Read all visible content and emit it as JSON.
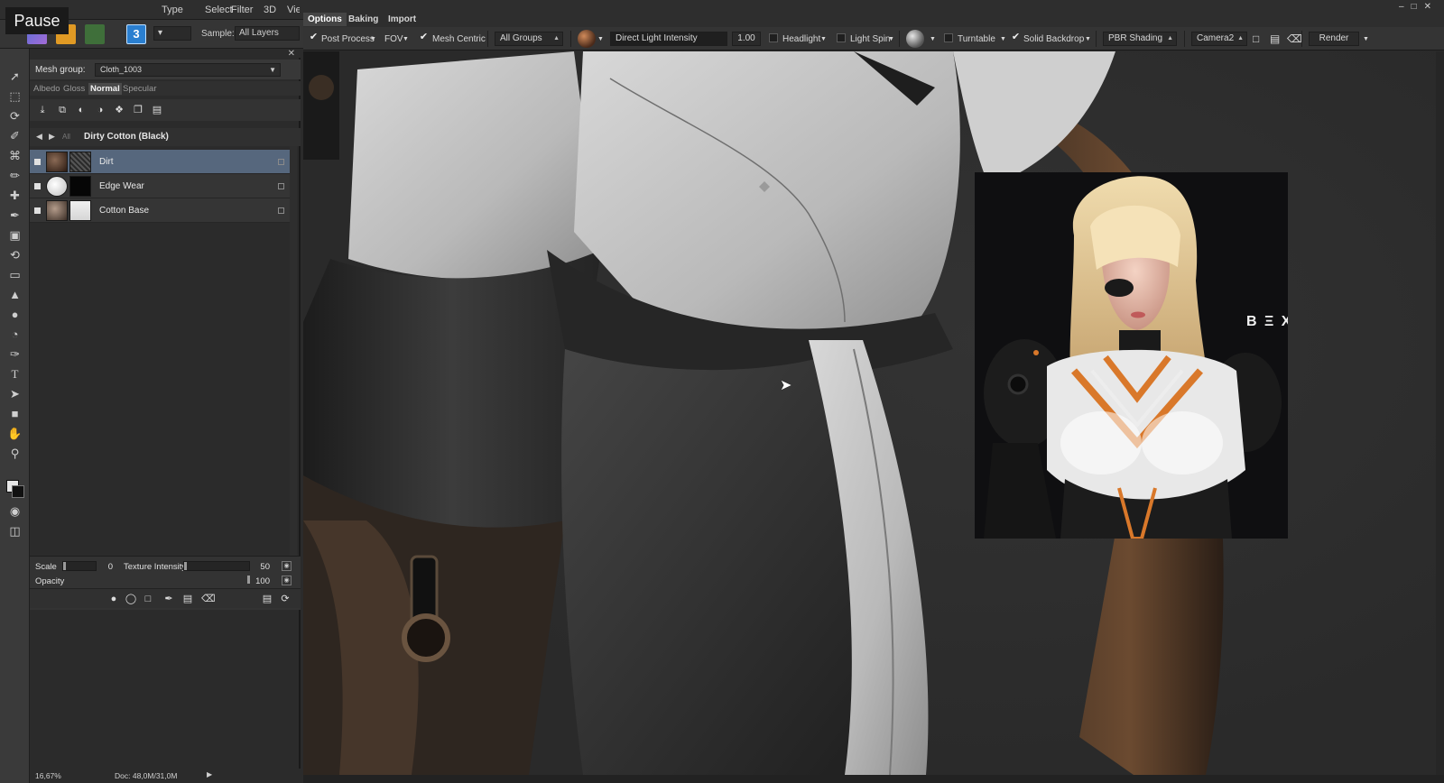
{
  "menubar": {
    "menus": [
      "Type",
      "Select",
      "Filter",
      "3D",
      "View"
    ],
    "overlay_label": "Pause",
    "window_controls": [
      "minimize-icon",
      "restore-icon",
      "close-icon"
    ]
  },
  "ps_options": {
    "sample_label": "Sample:",
    "sample_value": "All Layers"
  },
  "tools": [
    "move-icon",
    "marquee-icon",
    "lasso-icon",
    "quick-select-icon",
    "crop-icon",
    "eyedropper-icon",
    "healing-icon",
    "brush-icon",
    "stamp-icon",
    "history-brush-icon",
    "eraser-icon",
    "paint-bucket-icon",
    "blur-icon",
    "dodge-icon",
    "pen-icon",
    "type-icon",
    "path-select-icon",
    "shape-icon",
    "hand-icon",
    "zoom-icon"
  ],
  "panel": {
    "mesh_group_label": "Mesh group:",
    "mesh_group_value": "Cloth_1003",
    "channels": [
      "Albedo",
      "Gloss",
      "Normal",
      "Specular"
    ],
    "active_channel": "Normal",
    "breadcrumb_all": "All",
    "material_title": "Dirty Cotton (Black)",
    "layers": [
      {
        "name": "Dirt",
        "selected": true
      },
      {
        "name": "Edge Wear",
        "selected": false
      },
      {
        "name": "Cotton Base",
        "selected": false
      }
    ],
    "props": {
      "scale_label": "Scale",
      "scale_value": "0",
      "texture_intensity_label": "Texture Intensity",
      "texture_intensity_value": "50",
      "opacity_label": "Opacity",
      "opacity_value": "100"
    }
  },
  "status": {
    "zoom": "16,67%",
    "doc": "Doc: 48,0M/31,0M"
  },
  "plugin": {
    "tabs": [
      "Options",
      "Baking",
      "Import"
    ],
    "active_tab": "Options",
    "toolbar": {
      "post_process": "Post Process",
      "fov": "FOV",
      "mesh_centric": "Mesh Centric",
      "groups": "All Groups",
      "light_field_label": "Direct Light Intensity",
      "light_value": "1.00",
      "headlight": "Headlight",
      "light_spin": "Light Spin",
      "turntable": "Turntable",
      "solid_backdrop": "Solid Backdrop",
      "shading": "PBR Shading",
      "camera": "Camera2",
      "render": "Render"
    }
  },
  "reference": {
    "logo_text": "B Ξ X"
  },
  "colors": {
    "selection": "#56677d",
    "accent_orange": "#d9782a",
    "suit_white": "#c9c9c9",
    "suit_dark": "#3a3a3a"
  }
}
